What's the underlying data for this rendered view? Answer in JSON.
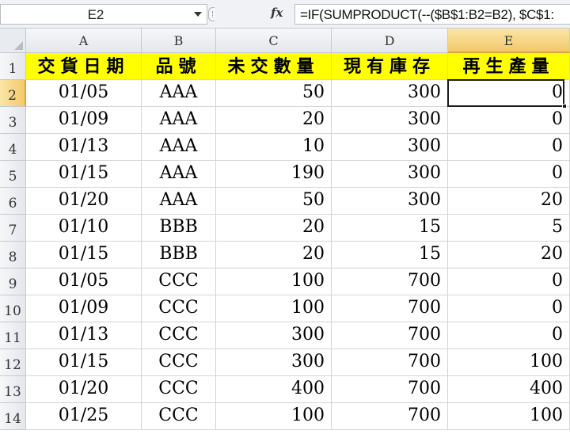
{
  "formula_bar": {
    "name_box": "E2",
    "fx_label": "fx",
    "formula": "=IF(SUMPRODUCT(--($B$1:B2=B2), $C$1:"
  },
  "columns": [
    "A",
    "B",
    "C",
    "D",
    "E"
  ],
  "selected_column": "E",
  "rows": [
    "1",
    "2",
    "3",
    "4",
    "5",
    "6",
    "7",
    "8",
    "9",
    "10",
    "11",
    "12",
    "13",
    "14"
  ],
  "selected_row": "2",
  "header": [
    "交貨日期",
    "品號",
    "未交數量",
    "現有庫存",
    "再生產量"
  ],
  "data": [
    [
      "01/05",
      "AAA",
      "50",
      "300",
      "0"
    ],
    [
      "01/09",
      "AAA",
      "20",
      "300",
      "0"
    ],
    [
      "01/13",
      "AAA",
      "10",
      "300",
      "0"
    ],
    [
      "01/15",
      "AAA",
      "190",
      "300",
      "0"
    ],
    [
      "01/20",
      "AAA",
      "50",
      "300",
      "20"
    ],
    [
      "01/10",
      "BBB",
      "20",
      "15",
      "5"
    ],
    [
      "01/15",
      "BBB",
      "20",
      "15",
      "20"
    ],
    [
      "01/05",
      "CCC",
      "100",
      "700",
      "0"
    ],
    [
      "01/09",
      "CCC",
      "100",
      "700",
      "0"
    ],
    [
      "01/13",
      "CCC",
      "300",
      "700",
      "0"
    ],
    [
      "01/15",
      "CCC",
      "300",
      "700",
      "100"
    ],
    [
      "01/20",
      "CCC",
      "400",
      "700",
      "400"
    ],
    [
      "01/25",
      "CCC",
      "100",
      "700",
      "100"
    ]
  ],
  "colors": {
    "header_fill": "#ffff00",
    "selection_accent": "#f3c96a"
  }
}
